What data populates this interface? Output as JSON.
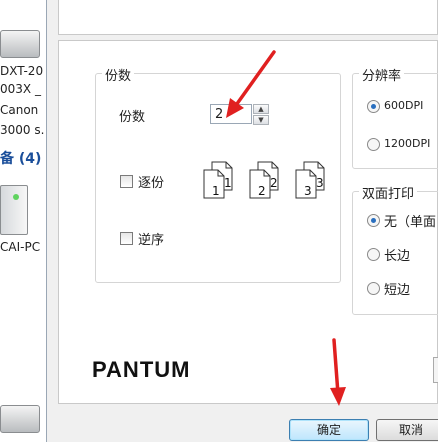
{
  "background": {
    "printer_1_lines": [
      "DXT-20",
      "003X _",
      "Canon",
      "3000 s."
    ],
    "group_label": "备 (4)",
    "pc_label": "CAI-PC"
  },
  "copies_group": {
    "title": "份数",
    "copies_label": "份数",
    "copies_value": "2",
    "collate_label": "逐份",
    "reverse_label": "逆序",
    "collate_pages": [
      {
        "front": "1",
        "back": "1"
      },
      {
        "front": "2",
        "back": "2"
      },
      {
        "front": "3",
        "back": "3"
      }
    ]
  },
  "resolution_group": {
    "title": "分辨率",
    "options": [
      {
        "label": "600DPI",
        "selected": true
      },
      {
        "label": "1200DPI",
        "selected": false
      }
    ]
  },
  "duplex_group": {
    "title": "双面打印",
    "options": [
      {
        "label": "无（单面",
        "selected": true
      },
      {
        "label": "长边",
        "selected": false
      },
      {
        "label": "短边",
        "selected": false
      }
    ]
  },
  "brand_logo": "PANTUM",
  "buttons": {
    "ok": "确定",
    "cancel": "取消"
  },
  "annotation_color": "#e02020"
}
